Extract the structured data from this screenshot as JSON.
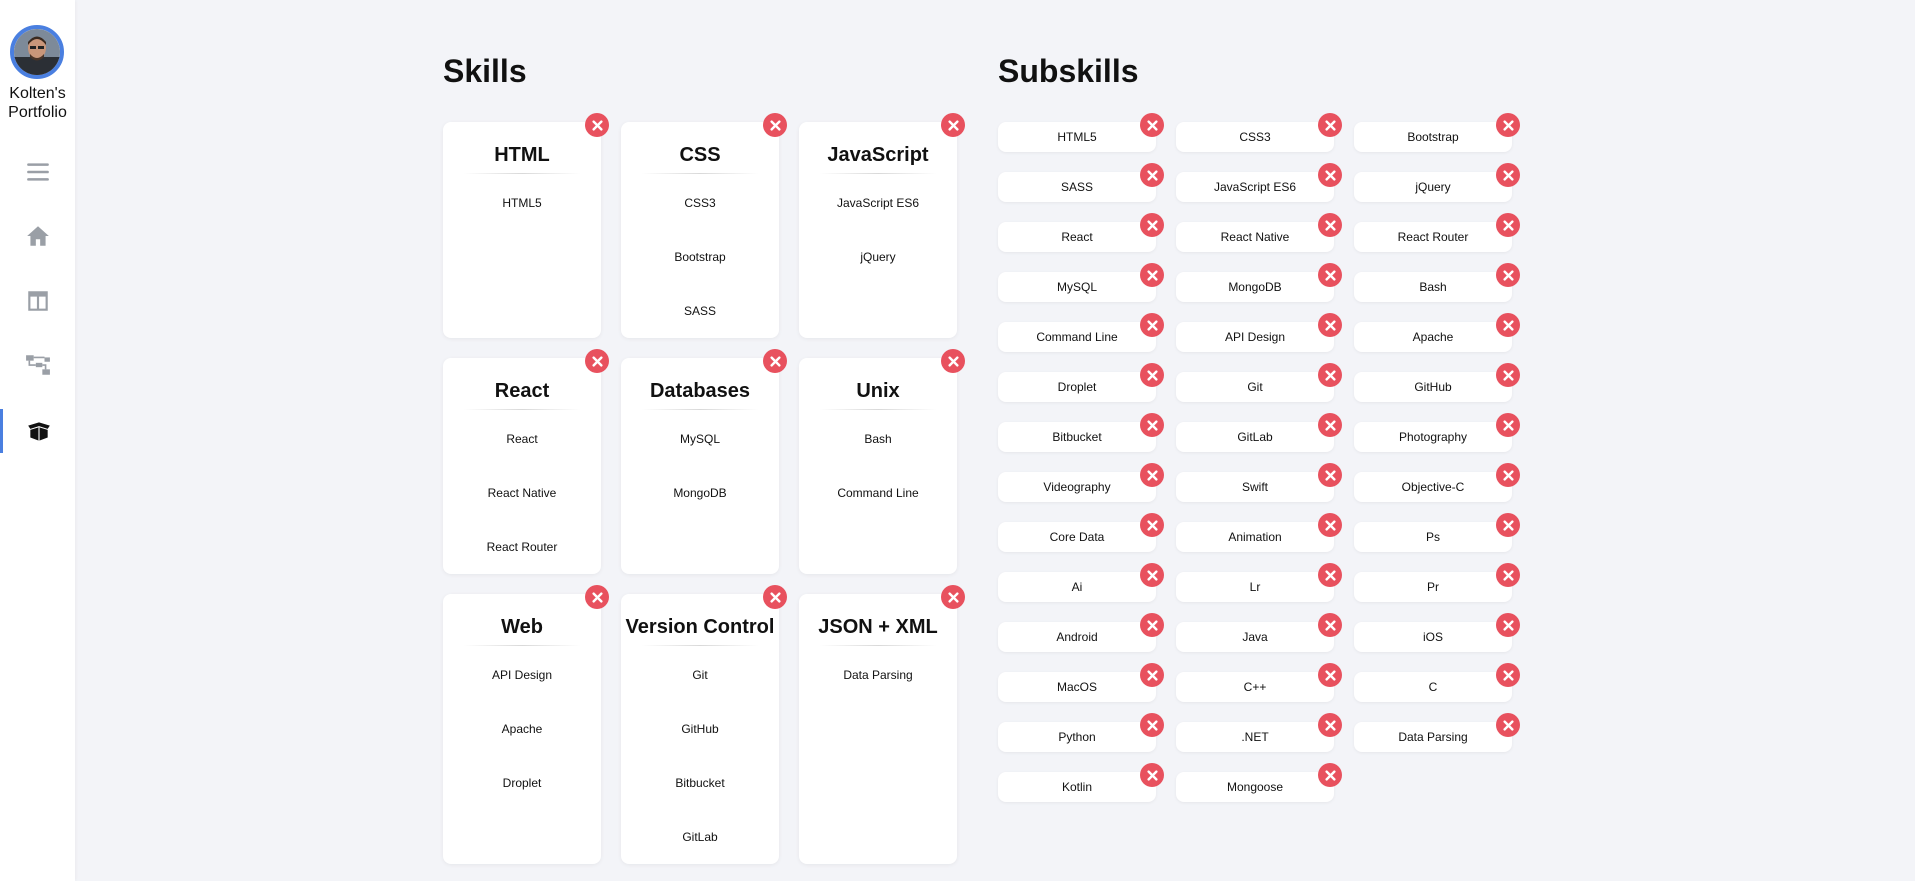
{
  "sidebar": {
    "brand_line1": "Kolten's",
    "brand_line2": "Portfolio",
    "nav": [
      {
        "icon": "menu-icon"
      },
      {
        "icon": "home-icon"
      },
      {
        "icon": "layout-icon"
      },
      {
        "icon": "sitemap-icon"
      },
      {
        "icon": "box-open-icon",
        "active": true
      }
    ]
  },
  "skills": {
    "title": "Skills",
    "cards": [
      {
        "title": "HTML",
        "items": [
          "HTML5"
        ]
      },
      {
        "title": "CSS",
        "items": [
          "CSS3",
          "Bootstrap",
          "SASS"
        ]
      },
      {
        "title": "JavaScript",
        "items": [
          "JavaScript ES6",
          "jQuery"
        ]
      },
      {
        "title": "React",
        "items": [
          "React",
          "React Native",
          "React Router"
        ]
      },
      {
        "title": "Databases",
        "items": [
          "MySQL",
          "MongoDB"
        ]
      },
      {
        "title": "Unix",
        "items": [
          "Bash",
          "Command Line"
        ]
      },
      {
        "title": "Web",
        "items": [
          "API Design",
          "Apache",
          "Droplet"
        ]
      },
      {
        "title": "Version Control",
        "items": [
          "Git",
          "GitHub",
          "Bitbucket",
          "GitLab"
        ]
      },
      {
        "title": "JSON + XML",
        "items": [
          "Data Parsing"
        ]
      }
    ]
  },
  "subskills": {
    "title": "Subskills",
    "items": [
      "HTML5",
      "CSS3",
      "Bootstrap",
      "SASS",
      "JavaScript ES6",
      "jQuery",
      "React",
      "React Native",
      "React Router",
      "MySQL",
      "MongoDB",
      "Bash",
      "Command Line",
      "API Design",
      "Apache",
      "Droplet",
      "Git",
      "GitHub",
      "Bitbucket",
      "GitLab",
      "Photography",
      "Videography",
      "Swift",
      "Objective-C",
      "Core Data",
      "Animation",
      "Ps",
      "Ai",
      "Lr",
      "Pr",
      "Android",
      "Java",
      "iOS",
      "MacOS",
      "C++",
      "C",
      "Python",
      ".NET",
      "Data Parsing",
      "Kotlin",
      "Mongoose"
    ]
  },
  "colors": {
    "accent": "#4a7fe0",
    "delete": "#e8515e",
    "background": "#f3f4f8"
  }
}
